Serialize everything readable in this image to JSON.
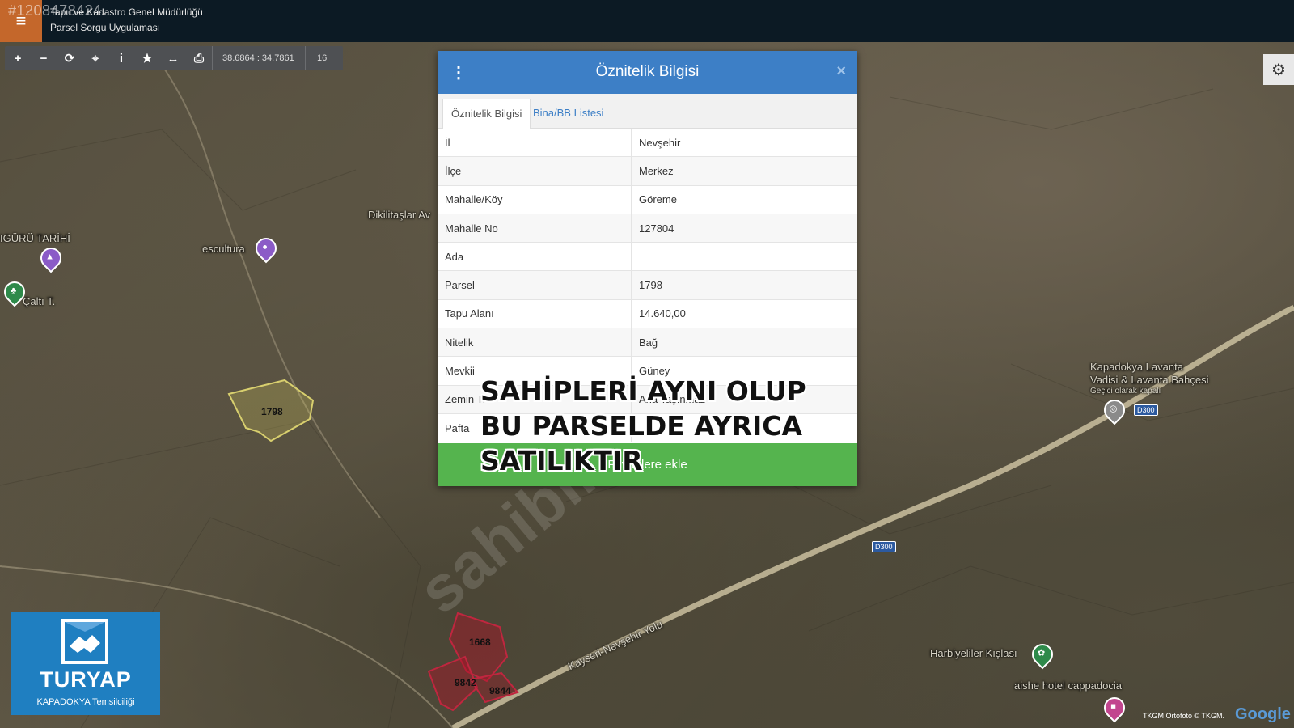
{
  "overlay_id": "#1208478424",
  "app": {
    "title_line1": "Tapu ve Kadastro Genel Müdürlüğü",
    "title_line2": "Parsel Sorgu Uygulaması"
  },
  "toolbar": {
    "buttons": [
      "zoom-in",
      "zoom-out",
      "refresh",
      "locate",
      "info",
      "favorite",
      "measure",
      "print"
    ],
    "coords": "38.6864 : 34.7861",
    "zoom": "16"
  },
  "map_labels": {
    "dikilitaslar": "Dikilitaşlar Av",
    "uguru": "IGÜRÜ TARİHİ",
    "escultura": "escultura",
    "calti": "Çaltı T.",
    "lavanta1": "Kapadokya Lavanta",
    "lavanta2": "Vadisi & Lavanta Bahçesi",
    "lavanta3": "Geçici olarak kapalı",
    "road": "Kayseri-Nevşehir Yolu",
    "harbiyeliler": "Harbiyeliler Kışlası",
    "aishe": "aishe hotel cappadocia",
    "d300": "D300"
  },
  "parcels": {
    "selected": "1798",
    "p1668": "1668",
    "p9842": "9842",
    "p9844": "9844"
  },
  "modal": {
    "title": "Öznitelik Bilgisi",
    "close": "×",
    "tabs": [
      "Öznitelik Bilgisi",
      "Bina/BB Listesi"
    ],
    "rows": [
      {
        "key": "İl",
        "value": "Nevşehir"
      },
      {
        "key": "İlçe",
        "value": "Merkez"
      },
      {
        "key": "Mahalle/Köy",
        "value": "Göreme"
      },
      {
        "key": "Mahalle No",
        "value": "127804"
      },
      {
        "key": "Ada",
        "value": ""
      },
      {
        "key": "Parsel",
        "value": "1798"
      },
      {
        "key": "Tapu Alanı",
        "value": "14.640,00"
      },
      {
        "key": "Nitelik",
        "value": "Bağ"
      },
      {
        "key": "Mevkii",
        "value": "Güney"
      },
      {
        "key": "Zemin Ti",
        "value": "Ana Taşınmaz"
      },
      {
        "key": "Pafta",
        "value": ""
      }
    ],
    "footer": "Favorilere ekle"
  },
  "banner": {
    "line1": "SAHİPLERİ AYNI OLUP",
    "line2": "BU PARSELDE AYRICA",
    "line3": "SATILIKTIR"
  },
  "logo": {
    "name": "TURYAP",
    "subtitle": "KAPADOKYA Temsilciliği"
  },
  "attribution": "TKGM Ortofoto © TKGM.",
  "google": "Google",
  "colors": {
    "header_blue": "#3d7fc6",
    "footer_green": "#55b44e",
    "menu_orange": "#c4672b",
    "topbar": "#0c1a24"
  }
}
